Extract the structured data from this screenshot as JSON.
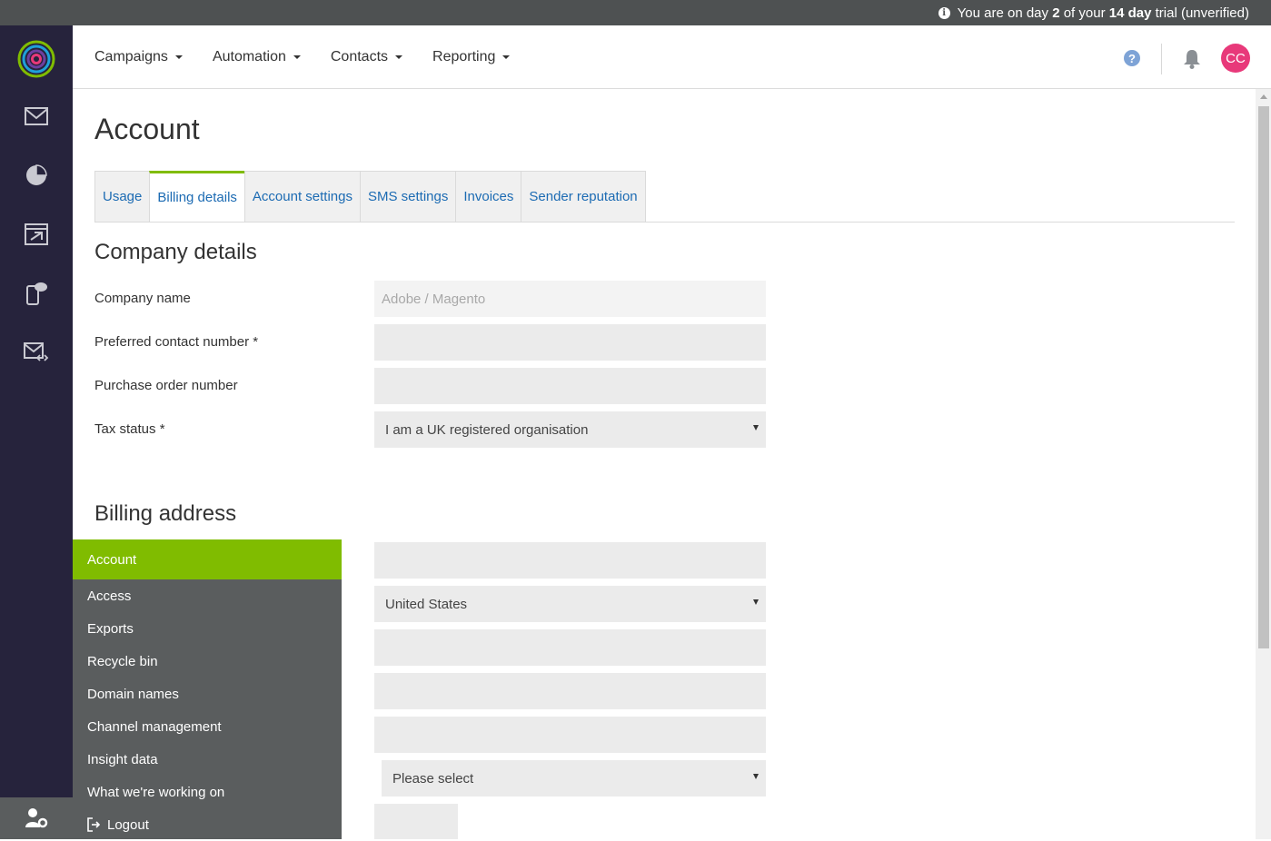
{
  "trial": {
    "prefix": "You are on day ",
    "day": "2",
    "mid": " of your ",
    "length": "14 day",
    "suffix": " trial (unverified)"
  },
  "rail": {
    "icons": [
      "logo-icon",
      "email-icon",
      "pie-chart-icon",
      "program-icon",
      "mobile-sms-icon",
      "email-code-icon",
      "account-settings-icon"
    ]
  },
  "topnav": {
    "items": [
      {
        "label": "Campaigns"
      },
      {
        "label": "Automation"
      },
      {
        "label": "Contacts"
      },
      {
        "label": "Reporting"
      }
    ],
    "help_label": "?",
    "avatar_initials": "CC"
  },
  "page": {
    "title": "Account",
    "tabs": [
      {
        "label": "Usage"
      },
      {
        "label": "Billing details"
      },
      {
        "label": "Account settings"
      },
      {
        "label": "SMS settings"
      },
      {
        "label": "Invoices"
      },
      {
        "label": "Sender reputation"
      }
    ],
    "active_tab": "Billing details"
  },
  "company": {
    "title": "Company details",
    "fields": [
      {
        "label": "Company name",
        "value": "Adobe / Magento"
      },
      {
        "label": "Preferred contact number *",
        "value": ""
      },
      {
        "label": "Purchase order number",
        "value": ""
      },
      {
        "label": "Tax status *",
        "value": "I am a UK registered organisation"
      }
    ]
  },
  "billing": {
    "title": "Billing address",
    "country": "United States",
    "state_placeholder": "Please select"
  },
  "account_menu": {
    "items": [
      {
        "label": "Account"
      },
      {
        "label": "Access"
      },
      {
        "label": "Exports"
      },
      {
        "label": "Recycle bin"
      },
      {
        "label": "Domain names"
      },
      {
        "label": "Channel management"
      },
      {
        "label": "Insight data"
      },
      {
        "label": "What we're working on"
      },
      {
        "label": "Logout"
      }
    ],
    "active": "Account"
  },
  "colors": {
    "rail": "#26233c",
    "accent_green": "#80bc00",
    "link_blue": "#1c6bb3",
    "avatar_pink": "#e8397a",
    "menu_grey": "#5a5d5e"
  }
}
